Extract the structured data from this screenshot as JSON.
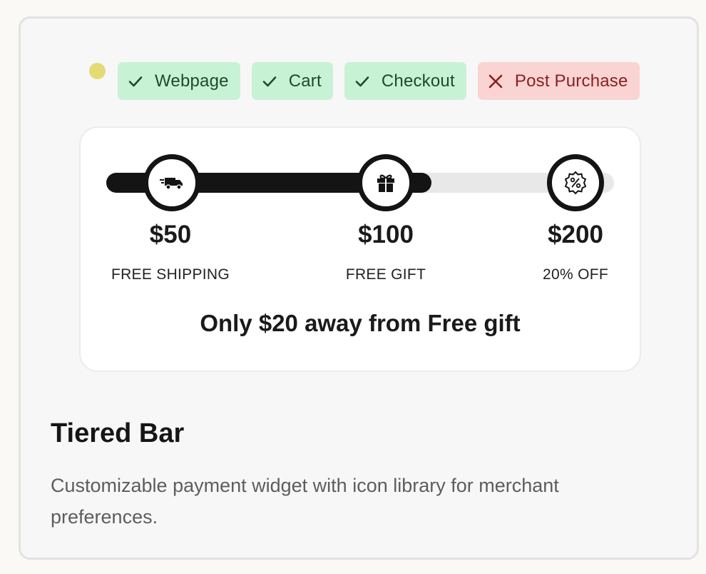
{
  "tags": [
    {
      "label": "Webpage",
      "status": "enabled",
      "icon": "check-icon"
    },
    {
      "label": "Cart",
      "status": "enabled",
      "icon": "check-icon"
    },
    {
      "label": "Checkout",
      "status": "enabled",
      "icon": "check-icon"
    },
    {
      "label": "Post Purchase",
      "status": "disabled",
      "icon": "x-icon"
    }
  ],
  "colors": {
    "enabled_bg": "#c8f2d4",
    "disabled_bg": "#fad3d3",
    "bar_fill": "#141414",
    "bar_track": "#e8e8e8",
    "status_dot": "#e3dc74"
  },
  "widget": {
    "progress_fraction": 0.64,
    "tiers": [
      {
        "amount": "$50",
        "reward": "FREE SHIPPING",
        "icon": "delivery-truck-icon"
      },
      {
        "amount": "$100",
        "reward": "FREE GIFT",
        "icon": "gift-icon"
      },
      {
        "amount": "$200",
        "reward": "20% OFF",
        "icon": "discount-badge-icon"
      }
    ],
    "message": "Only $20 away from Free gift"
  },
  "card": {
    "title": "Tiered Bar",
    "description": "Customizable payment widget with icon library for merchant preferences."
  }
}
